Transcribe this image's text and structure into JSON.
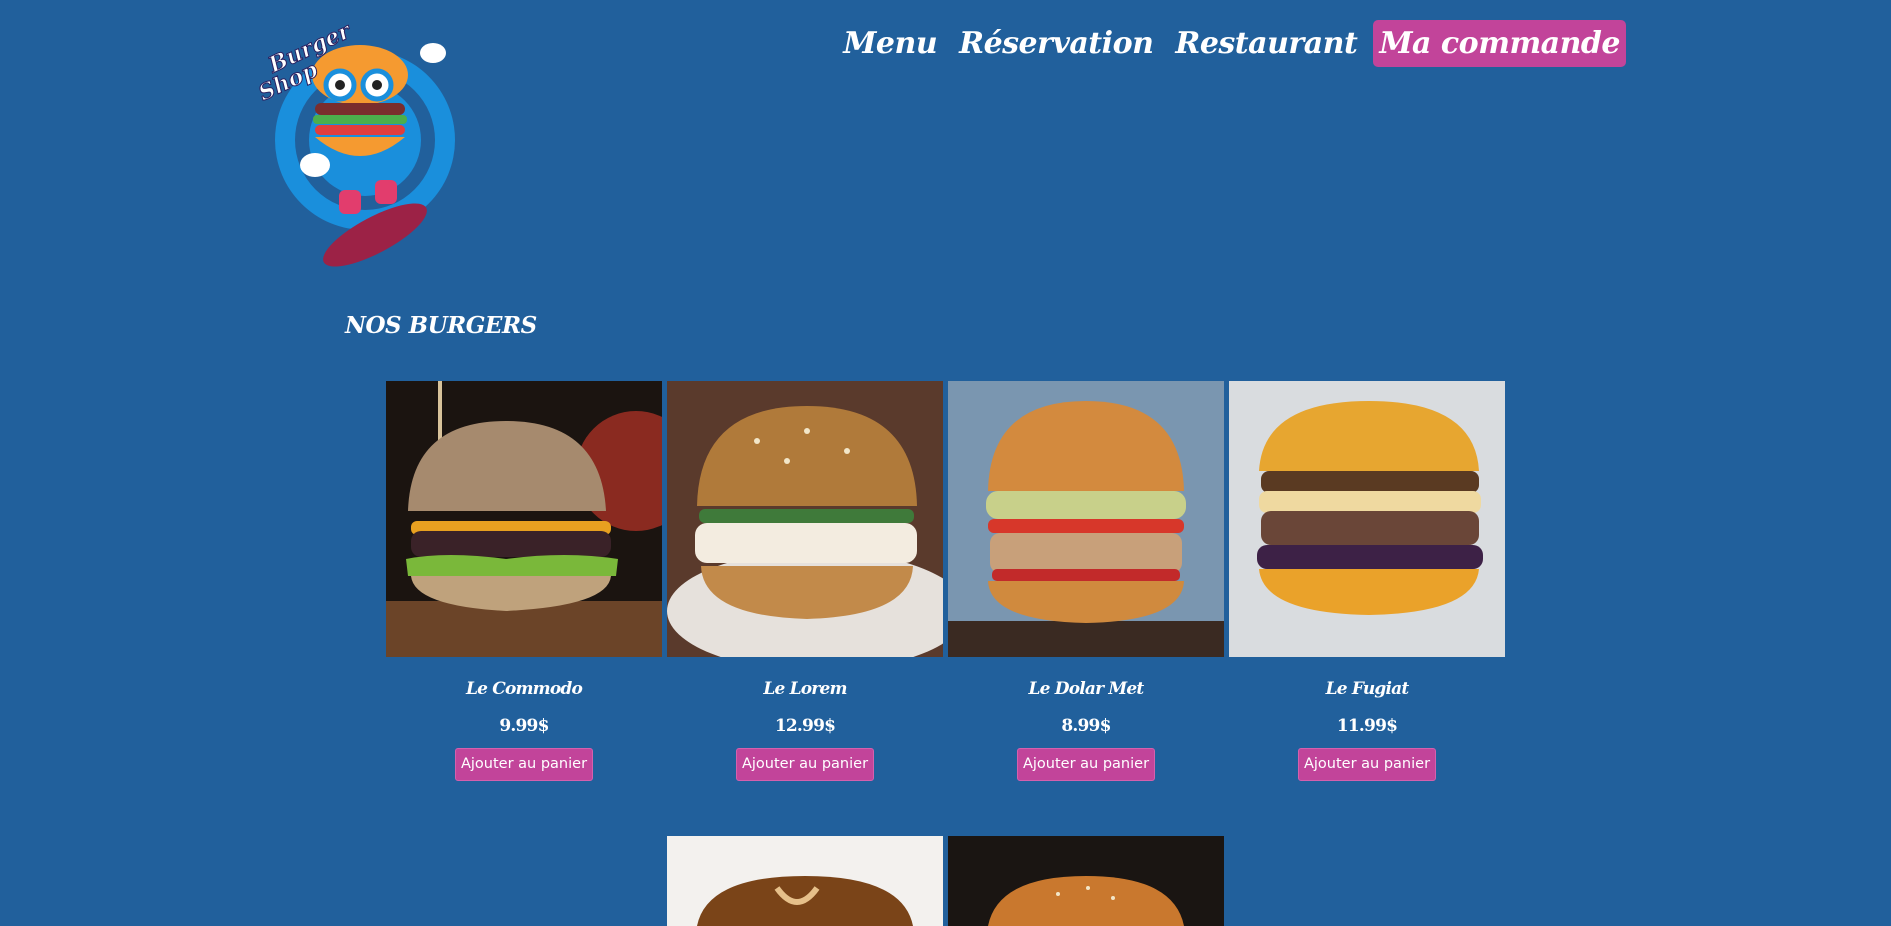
{
  "logo": {
    "line1": "Burger",
    "line2": "Shop"
  },
  "nav": {
    "items": [
      {
        "label": "Menu"
      },
      {
        "label": "Réservation"
      },
      {
        "label": "Restaurant"
      },
      {
        "label": "Ma commande",
        "active": true
      }
    ]
  },
  "section": {
    "title": "NOS BURGERS"
  },
  "products": [
    {
      "name": "Le Commodo",
      "price": "9.99$",
      "button": "Ajouter au panier"
    },
    {
      "name": "Le Lorem",
      "price": "12.99$",
      "button": "Ajouter au panier"
    },
    {
      "name": "Le Dolar Met",
      "price": "8.99$",
      "button": "Ajouter au panier"
    },
    {
      "name": "Le Fugiat",
      "price": "11.99$",
      "button": "Ajouter au panier"
    }
  ],
  "colors": {
    "background": "#21609c",
    "accent": "#c2449a"
  }
}
